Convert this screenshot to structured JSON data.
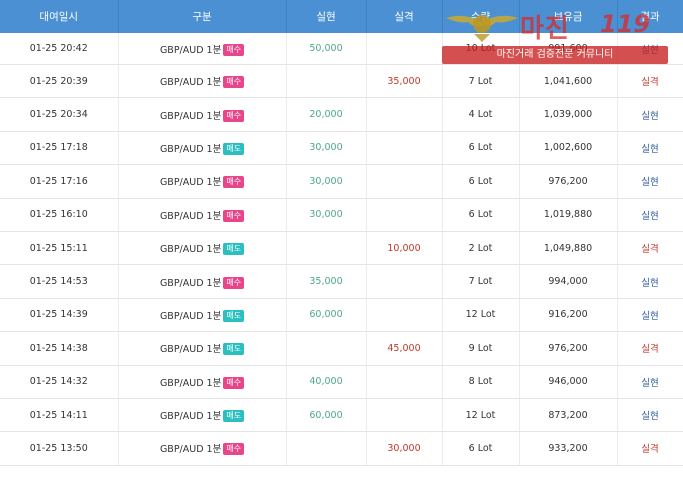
{
  "table": {
    "headers": [
      "대여일시",
      "구분",
      "실현",
      "실격",
      "수량",
      "보유금",
      "결과"
    ],
    "rows": [
      {
        "date": "01-25 20:42",
        "product": "GBP/AUD 1분",
        "side": "매수",
        "side_type": "buy",
        "win": "50,000",
        "loss": "",
        "qty": "10 Lot",
        "balance": "991,600",
        "result": "실현",
        "result_type": "win"
      },
      {
        "date": "01-25 20:39",
        "product": "GBP/AUD 1분",
        "side": "매수",
        "side_type": "buy",
        "win": "",
        "loss": "35,000",
        "qty": "7 Lot",
        "balance": "1,041,600",
        "result": "실격",
        "result_type": "loss"
      },
      {
        "date": "01-25 20:34",
        "product": "GBP/AUD 1분",
        "side": "매수",
        "side_type": "buy",
        "win": "20,000",
        "loss": "",
        "qty": "4 Lot",
        "balance": "1,039,000",
        "result": "실현",
        "result_type": "win"
      },
      {
        "date": "01-25 17:18",
        "product": "GBP/AUD 1분",
        "side": "매도",
        "side_type": "sell",
        "win": "30,000",
        "loss": "",
        "qty": "6 Lot",
        "balance": "1,002,600",
        "result": "실현",
        "result_type": "win"
      },
      {
        "date": "01-25 17:16",
        "product": "GBP/AUD 1분",
        "side": "매수",
        "side_type": "buy",
        "win": "30,000",
        "loss": "",
        "qty": "6 Lot",
        "balance": "976,200",
        "result": "실현",
        "result_type": "win"
      },
      {
        "date": "01-25 16:10",
        "product": "GBP/AUD 1분",
        "side": "매수",
        "side_type": "buy",
        "win": "30,000",
        "loss": "",
        "qty": "6 Lot",
        "balance": "1,019,880",
        "result": "실현",
        "result_type": "win"
      },
      {
        "date": "01-25 15:11",
        "product": "GBP/AUD 1분",
        "side": "매도",
        "side_type": "sell",
        "win": "",
        "loss": "10,000",
        "qty": "2 Lot",
        "balance": "1,049,880",
        "result": "실격",
        "result_type": "loss"
      },
      {
        "date": "01-25 14:53",
        "product": "GBP/AUD 1분",
        "side": "매수",
        "side_type": "buy",
        "win": "35,000",
        "loss": "",
        "qty": "7 Lot",
        "balance": "994,000",
        "result": "실현",
        "result_type": "win"
      },
      {
        "date": "01-25 14:39",
        "product": "GBP/AUD 1분",
        "side": "매도",
        "side_type": "sell",
        "win": "60,000",
        "loss": "",
        "qty": "12 Lot",
        "balance": "916,200",
        "result": "실현",
        "result_type": "win"
      },
      {
        "date": "01-25 14:38",
        "product": "GBP/AUD 1분",
        "side": "매도",
        "side_type": "sell",
        "win": "",
        "loss": "45,000",
        "qty": "9 Lot",
        "balance": "976,200",
        "result": "실격",
        "result_type": "loss"
      },
      {
        "date": "01-25 14:32",
        "product": "GBP/AUD 1분",
        "side": "매수",
        "side_type": "buy",
        "win": "40,000",
        "loss": "",
        "qty": "8 Lot",
        "balance": "946,000",
        "result": "실현",
        "result_type": "win"
      },
      {
        "date": "01-25 14:11",
        "product": "GBP/AUD 1분",
        "side": "매도",
        "side_type": "sell",
        "win": "60,000",
        "loss": "",
        "qty": "12 Lot",
        "balance": "873,200",
        "result": "실현",
        "result_type": "win"
      },
      {
        "date": "01-25 13:50",
        "product": "GBP/AUD 1분",
        "side": "매수",
        "side_type": "buy",
        "win": "",
        "loss": "30,000",
        "qty": "6 Lot",
        "balance": "933,200",
        "result": "실격",
        "result_type": "loss"
      }
    ]
  },
  "watermark": {
    "title": "마진",
    "number": "119",
    "subtitle": "마진거래 검증전문 커뮤니티"
  }
}
